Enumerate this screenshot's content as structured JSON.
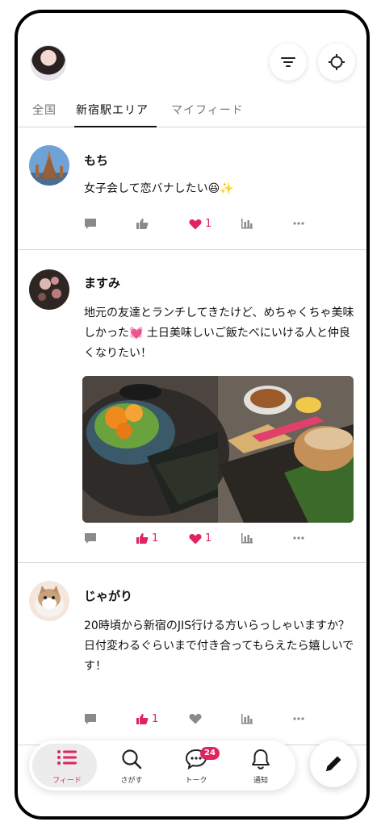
{
  "colors": {
    "accent": "#e0245e",
    "icon_gray": "#8a8a8a",
    "divider": "#d6d6d6"
  },
  "header": {
    "tabs": [
      {
        "label": "全国",
        "active": false
      },
      {
        "label": "新宿駅エリア",
        "active": true
      },
      {
        "label": "マイフィード",
        "active": false
      }
    ],
    "icons": [
      "filter-icon",
      "location-icon"
    ]
  },
  "posts": [
    {
      "name": "もち",
      "text": "女子会して恋バナしたい😆✨",
      "actions": {
        "comment": "",
        "like": "",
        "heart": "1",
        "stats": "",
        "more": ""
      },
      "liked": false,
      "hearted": true,
      "has_image": false
    },
    {
      "name": "ますみ",
      "text": "地元の友達とランチしてきたけど、めちゃくちゃ美味しかった💓 土日美味しいご飯たべにいける人と仲良くなりたい！",
      "actions": {
        "comment": "",
        "like": "1",
        "heart": "1",
        "stats": "",
        "more": ""
      },
      "liked": true,
      "hearted": true,
      "has_image": true
    },
    {
      "name": "じゃがり",
      "text": "20時頃から新宿のJIS行ける方いらっしゃいますか？\n日付変わるぐらいまで付き合ってもらえたら嬉しいです！",
      "actions": {
        "comment": "",
        "like": "1",
        "heart": "",
        "stats": "",
        "more": ""
      },
      "liked": true,
      "hearted": false,
      "has_image": false
    }
  ],
  "bottom_nav": {
    "items": [
      {
        "label": "フィード",
        "icon": "list-icon",
        "active": true
      },
      {
        "label": "さがす",
        "icon": "search-icon",
        "active": false
      },
      {
        "label": "トーク",
        "icon": "chat-icon",
        "active": false,
        "badge": "24"
      },
      {
        "label": "通知",
        "icon": "bell-icon",
        "active": false
      }
    ],
    "compose_icon": "pencil-icon"
  }
}
